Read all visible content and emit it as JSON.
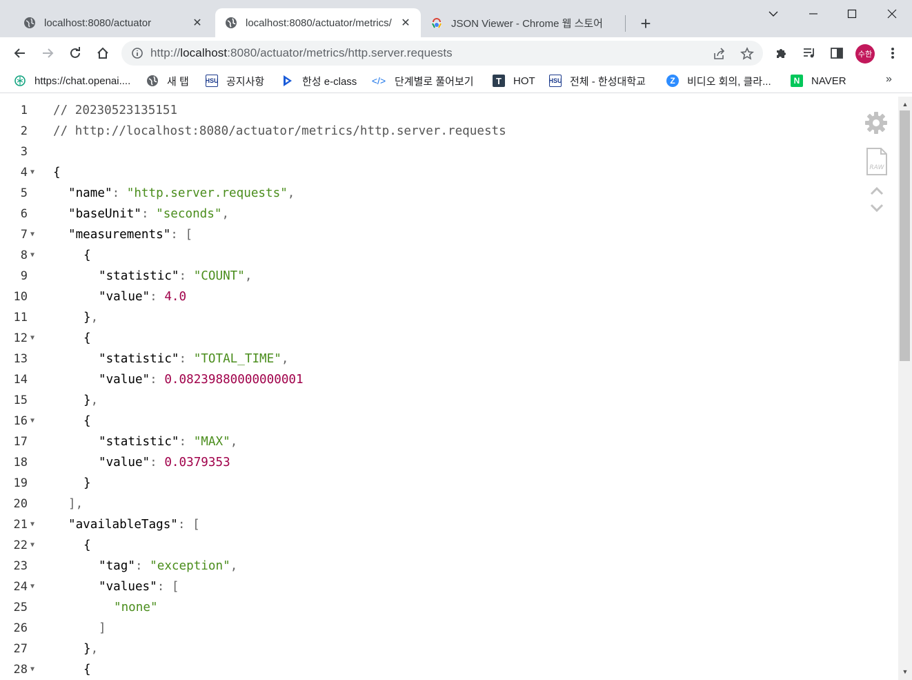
{
  "tabs": [
    {
      "title": "localhost:8080/actuator",
      "icon": "globe-icon",
      "active": false
    },
    {
      "title": "localhost:8080/actuator/metrics/",
      "icon": "globe-icon",
      "active": true
    },
    {
      "title": "JSON Viewer - Chrome 웹 스토어",
      "icon": "chrome-webstore-icon",
      "active": false
    }
  ],
  "toolbar": {
    "url_scheme": "http://",
    "url_host": "localhost",
    "url_rest": ":8080/actuator/metrics/http.server.requests",
    "avatar_text": "수한"
  },
  "bookmarks": [
    {
      "label": "https://chat.openai....",
      "icon": "openai-icon",
      "color": "#10a37f"
    },
    {
      "label": "새 탭",
      "icon": "globe-icon",
      "color": "#5f6368"
    },
    {
      "label": "공지사항",
      "icon": "hsu-icon",
      "color": "#1b3a8c"
    },
    {
      "label": "한성 e-class",
      "icon": "eclass-icon",
      "color": "#1a5bd8"
    },
    {
      "label": "단계별로 풀어보기",
      "icon": "code-icon",
      "color": "#1a73e8"
    },
    {
      "label": "HOT",
      "icon": "tistory-icon",
      "color": "#2d3e50"
    },
    {
      "label": "전체 - 한성대학교",
      "icon": "hsu-icon",
      "color": "#1b3a8c"
    },
    {
      "label": "비디오 회의, 클라...",
      "icon": "zoom-icon",
      "color": "#2d8cff"
    },
    {
      "label": "NAVER",
      "icon": "naver-icon",
      "color": "#03c75a"
    }
  ],
  "bookmarks_more": "»",
  "json_lines": [
    {
      "n": "1",
      "fold": false,
      "indent": 0,
      "parts": [
        [
          "c",
          "// 20230523135151"
        ]
      ]
    },
    {
      "n": "2",
      "fold": false,
      "indent": 0,
      "parts": [
        [
          "c",
          "// http://localhost:8080/actuator/metrics/http.server.requests"
        ]
      ]
    },
    {
      "n": "3",
      "fold": false,
      "indent": 0,
      "parts": []
    },
    {
      "n": "4",
      "fold": true,
      "indent": 0,
      "parts": [
        [
          "b",
          "{"
        ]
      ]
    },
    {
      "n": "5",
      "fold": false,
      "indent": 1,
      "parts": [
        [
          "k",
          "\"name\""
        ],
        [
          "p",
          ": "
        ],
        [
          "s",
          "\"http.server.requests\""
        ],
        [
          "p",
          ","
        ]
      ]
    },
    {
      "n": "6",
      "fold": false,
      "indent": 1,
      "parts": [
        [
          "k",
          "\"baseUnit\""
        ],
        [
          "p",
          ": "
        ],
        [
          "s",
          "\"seconds\""
        ],
        [
          "p",
          ","
        ]
      ]
    },
    {
      "n": "7",
      "fold": true,
      "indent": 1,
      "parts": [
        [
          "k",
          "\"measurements\""
        ],
        [
          "p",
          ": ["
        ]
      ]
    },
    {
      "n": "8",
      "fold": true,
      "indent": 2,
      "parts": [
        [
          "b",
          "{"
        ]
      ]
    },
    {
      "n": "9",
      "fold": false,
      "indent": 3,
      "parts": [
        [
          "k",
          "\"statistic\""
        ],
        [
          "p",
          ": "
        ],
        [
          "s",
          "\"COUNT\""
        ],
        [
          "p",
          ","
        ]
      ]
    },
    {
      "n": "10",
      "fold": false,
      "indent": 3,
      "parts": [
        [
          "k",
          "\"value\""
        ],
        [
          "p",
          ": "
        ],
        [
          "n",
          "4.0"
        ]
      ]
    },
    {
      "n": "11",
      "fold": false,
      "indent": 2,
      "parts": [
        [
          "b",
          "}"
        ],
        [
          "p",
          ","
        ]
      ]
    },
    {
      "n": "12",
      "fold": true,
      "indent": 2,
      "parts": [
        [
          "b",
          "{"
        ]
      ]
    },
    {
      "n": "13",
      "fold": false,
      "indent": 3,
      "parts": [
        [
          "k",
          "\"statistic\""
        ],
        [
          "p",
          ": "
        ],
        [
          "s",
          "\"TOTAL_TIME\""
        ],
        [
          "p",
          ","
        ]
      ]
    },
    {
      "n": "14",
      "fold": false,
      "indent": 3,
      "parts": [
        [
          "k",
          "\"value\""
        ],
        [
          "p",
          ": "
        ],
        [
          "n",
          "0.08239880000000001"
        ]
      ]
    },
    {
      "n": "15",
      "fold": false,
      "indent": 2,
      "parts": [
        [
          "b",
          "}"
        ],
        [
          "p",
          ","
        ]
      ]
    },
    {
      "n": "16",
      "fold": true,
      "indent": 2,
      "parts": [
        [
          "b",
          "{"
        ]
      ]
    },
    {
      "n": "17",
      "fold": false,
      "indent": 3,
      "parts": [
        [
          "k",
          "\"statistic\""
        ],
        [
          "p",
          ": "
        ],
        [
          "s",
          "\"MAX\""
        ],
        [
          "p",
          ","
        ]
      ]
    },
    {
      "n": "18",
      "fold": false,
      "indent": 3,
      "parts": [
        [
          "k",
          "\"value\""
        ],
        [
          "p",
          ": "
        ],
        [
          "n",
          "0.0379353"
        ]
      ]
    },
    {
      "n": "19",
      "fold": false,
      "indent": 2,
      "parts": [
        [
          "b",
          "}"
        ]
      ]
    },
    {
      "n": "20",
      "fold": false,
      "indent": 1,
      "parts": [
        [
          "p",
          "],"
        ]
      ]
    },
    {
      "n": "21",
      "fold": true,
      "indent": 1,
      "parts": [
        [
          "k",
          "\"availableTags\""
        ],
        [
          "p",
          ": ["
        ]
      ]
    },
    {
      "n": "22",
      "fold": true,
      "indent": 2,
      "parts": [
        [
          "b",
          "{"
        ]
      ]
    },
    {
      "n": "23",
      "fold": false,
      "indent": 3,
      "parts": [
        [
          "k",
          "\"tag\""
        ],
        [
          "p",
          ": "
        ],
        [
          "s",
          "\"exception\""
        ],
        [
          "p",
          ","
        ]
      ]
    },
    {
      "n": "24",
      "fold": true,
      "indent": 3,
      "parts": [
        [
          "k",
          "\"values\""
        ],
        [
          "p",
          ": ["
        ]
      ]
    },
    {
      "n": "25",
      "fold": false,
      "indent": 4,
      "parts": [
        [
          "s",
          "\"none\""
        ]
      ]
    },
    {
      "n": "26",
      "fold": false,
      "indent": 3,
      "parts": [
        [
          "p",
          "]"
        ]
      ]
    },
    {
      "n": "27",
      "fold": false,
      "indent": 2,
      "parts": [
        [
          "b",
          "}"
        ],
        [
          "p",
          ","
        ]
      ]
    },
    {
      "n": "28",
      "fold": true,
      "indent": 2,
      "parts": [
        [
          "b",
          "{"
        ]
      ]
    }
  ],
  "side_icons": [
    "settings-gear-icon",
    "raw-file-icon",
    "chevron-up-icon",
    "chevron-down-icon"
  ],
  "colors": {
    "string": "#4a8d1c",
    "number": "#a0004a",
    "comment": "#555555"
  }
}
